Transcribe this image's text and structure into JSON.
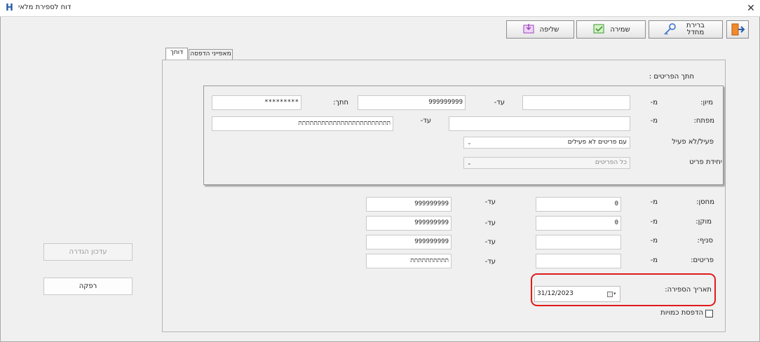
{
  "window": {
    "title": "דוח לספירת מלאי",
    "app_icon": "H",
    "close": "✕"
  },
  "toolbar": {
    "check_default_label": "ברירת מחדל",
    "save_label": "שמירה",
    "send_label": "שליפה"
  },
  "tabs": [
    {
      "label": "דוחך"
    },
    {
      "label": "מאפייני הדפסה"
    }
  ],
  "group": {
    "title": "חתך הפריטים :",
    "row1": {
      "label": "מיון:",
      "from": "מ-",
      "from_value": "",
      "to": "עד-",
      "to_value": "999999999",
      "cut_label": "חתך:",
      "cut_value": "*********"
    },
    "row2": {
      "label": "מפתח:",
      "from": "מ-",
      "from_value": "",
      "to": "עד-",
      "to_value": "תתתתתתתתתתתתתתתתתתתתתתתת"
    },
    "row3": {
      "label": "פעיל/לא פעיל",
      "value": "עם פריטים לא פעילים"
    },
    "row4": {
      "label": "יחידת פריט",
      "value": "כל הפריטים"
    }
  },
  "filters": [
    {
      "label": "מחסן:",
      "from": "מ-",
      "from_value": "0",
      "to": "עד-",
      "to_value": "999999999"
    },
    {
      "label": "מוקן:",
      "from": "מ-",
      "from_value": "0",
      "to": "עד-",
      "to_value": "999999999"
    },
    {
      "label": "סניף:",
      "from": "מ-",
      "from_value": "",
      "to": "עד-",
      "to_value": "999999999"
    },
    {
      "label": "פריטים:",
      "from": "מ-",
      "from_value": "",
      "to": "עד-",
      "to_value": "תתתתתתתתתת"
    }
  ],
  "count_date": {
    "label": "תאריך הספירה:",
    "value": "31/12/2023"
  },
  "print_checkbox": {
    "label": "הדפסת כמויות",
    "checked": false
  },
  "side": {
    "update_label": "עדכון הגדרה",
    "report_label": "רפקה"
  }
}
